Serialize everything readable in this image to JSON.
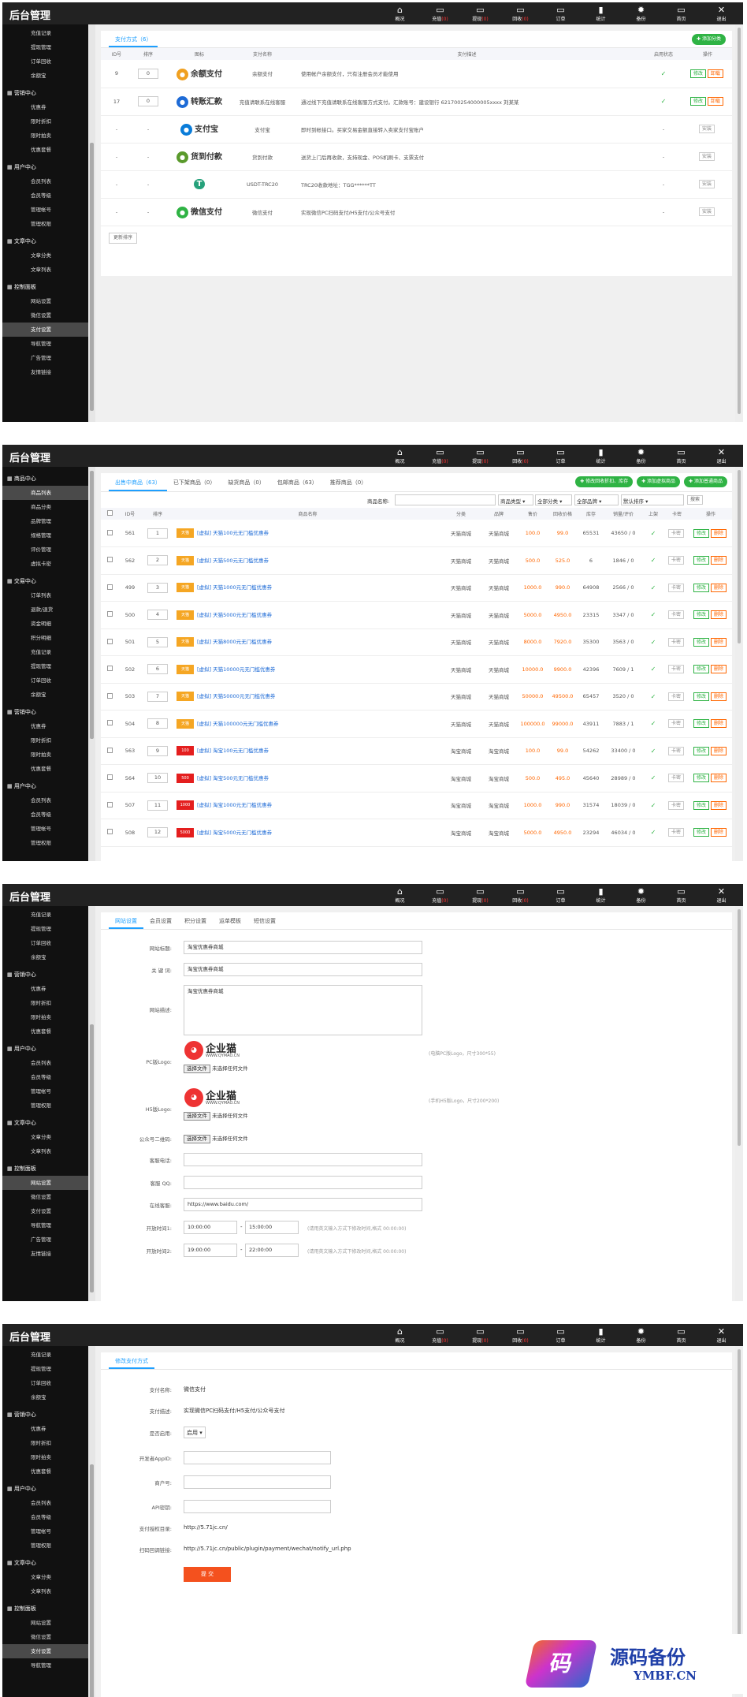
{
  "app": {
    "logo": "后台管理"
  },
  "nav": [
    {
      "icon": "home-icon",
      "label": "概况",
      "count": ""
    },
    {
      "icon": "monitor-icon",
      "label": "充值",
      "count": "(0)"
    },
    {
      "icon": "monitor-icon",
      "label": "提现",
      "count": "(0)"
    },
    {
      "icon": "monitor-icon",
      "label": "回收",
      "count": "(0)"
    },
    {
      "icon": "monitor-icon",
      "label": "订单",
      "count": ""
    },
    {
      "icon": "chart-icon",
      "label": "统计",
      "count": ""
    },
    {
      "icon": "gear-icon",
      "label": "备份",
      "count": ""
    },
    {
      "icon": "monitor-icon",
      "label": "首页",
      "count": ""
    },
    {
      "icon": "close-icon",
      "label": "退出",
      "count": ""
    }
  ],
  "panel1": {
    "sidebar": [
      {
        "type": "item",
        "label": "充值记录"
      },
      {
        "type": "item",
        "label": "提现管理"
      },
      {
        "type": "item",
        "label": "订单回收"
      },
      {
        "type": "item",
        "label": "余额宝"
      },
      {
        "type": "group",
        "label": "营销中心"
      },
      {
        "type": "item",
        "label": "优惠券"
      },
      {
        "type": "item",
        "label": "限时折扣"
      },
      {
        "type": "item",
        "label": "限时拍卖"
      },
      {
        "type": "item",
        "label": "优惠套餐"
      },
      {
        "type": "group",
        "label": "用户中心"
      },
      {
        "type": "item",
        "label": "会员列表"
      },
      {
        "type": "item",
        "label": "会员等级"
      },
      {
        "type": "item",
        "label": "管理帐号"
      },
      {
        "type": "item",
        "label": "管理权限"
      },
      {
        "type": "group",
        "label": "文章中心"
      },
      {
        "type": "item",
        "label": "文章分类"
      },
      {
        "type": "item",
        "label": "文章列表"
      },
      {
        "type": "group",
        "label": "控制面板"
      },
      {
        "type": "item",
        "label": "网站设置"
      },
      {
        "type": "item",
        "label": "微信设置"
      },
      {
        "type": "item",
        "label": "支付设置",
        "active": true
      },
      {
        "type": "item",
        "label": "导航管理"
      },
      {
        "type": "item",
        "label": "广告管理"
      },
      {
        "type": "item",
        "label": "友情链接"
      }
    ],
    "tab": "支付方式（6）",
    "add_button": "添加分类",
    "columns": [
      "ID号",
      "排序",
      "图标",
      "支付名称",
      "支付描述",
      "启用状态",
      "操作"
    ],
    "rows": [
      {
        "id": "9",
        "order": "0",
        "logo": "余额支付",
        "logo_icon": "wallet-icon",
        "logo_color": "#f0a020",
        "name": "余额支付",
        "desc": "使用帐户余额支付，只有注册会员才能使用",
        "status": "✓",
        "actions": [
          "修改",
          "卸载"
        ]
      },
      {
        "id": "17",
        "order": "0",
        "logo": "转账汇款",
        "logo_icon": "transfer-icon",
        "logo_color": "#1e6bd6",
        "name": "充值请联系在线客服",
        "desc": "通过线下充值请联系在线客服方式支付。汇款账号：建设银行 621700254000005xxxx 刘某某",
        "status": "✓",
        "actions": [
          "修改",
          "卸载"
        ]
      },
      {
        "id": "-",
        "order": "-",
        "logo": "支付宝",
        "logo_icon": "alipay-icon",
        "logo_color": "#0a7cd9",
        "name": "支付宝",
        "desc": "即时到帐接口。买家交易金额直接转入卖家支付宝账户",
        "status": "-",
        "actions": [
          "安装"
        ]
      },
      {
        "id": "-",
        "order": "-",
        "logo": "货到付款",
        "logo_icon": "truck-icon",
        "logo_color": "#5a9a2c",
        "name": "货到付款",
        "desc": "送货上门后再收款，支持现金、POS机刷卡、支票支付",
        "status": "-",
        "actions": [
          "安装"
        ]
      },
      {
        "id": "-",
        "order": "-",
        "logo": "T",
        "logo_icon": "tether-icon",
        "logo_color": "#26a17b",
        "name": "USDT-TRC20",
        "desc": "TRC20收款地址：TGG******TT",
        "status": "-",
        "actions": [
          "安装"
        ]
      },
      {
        "id": "-",
        "order": "-",
        "logo": "微信支付",
        "logo_icon": "wechat-icon",
        "logo_color": "#2fb344",
        "name": "微信支付",
        "desc": "实现微信PC扫码支付/H5支付/公众号支付",
        "status": "-",
        "actions": [
          "安装"
        ]
      }
    ],
    "update_button": "更新排序"
  },
  "panel2": {
    "sidebar": [
      {
        "type": "group",
        "label": "商品中心"
      },
      {
        "type": "item",
        "label": "商品列表",
        "active": true
      },
      {
        "type": "item",
        "label": "商品分类"
      },
      {
        "type": "item",
        "label": "品牌管理"
      },
      {
        "type": "item",
        "label": "规格管理"
      },
      {
        "type": "item",
        "label": "评价管理"
      },
      {
        "type": "item",
        "label": "虚拟卡密"
      },
      {
        "type": "group",
        "label": "交易中心"
      },
      {
        "type": "item",
        "label": "订单列表"
      },
      {
        "type": "item",
        "label": "退款/退货"
      },
      {
        "type": "item",
        "label": "资金明细"
      },
      {
        "type": "item",
        "label": "积分明细"
      },
      {
        "type": "item",
        "label": "充值记录"
      },
      {
        "type": "item",
        "label": "提现管理"
      },
      {
        "type": "item",
        "label": "订单回收"
      },
      {
        "type": "item",
        "label": "余额宝"
      },
      {
        "type": "group",
        "label": "营销中心"
      },
      {
        "type": "item",
        "label": "优惠券"
      },
      {
        "type": "item",
        "label": "限时折扣"
      },
      {
        "type": "item",
        "label": "限时拍卖"
      },
      {
        "type": "item",
        "label": "优惠套餐"
      },
      {
        "type": "group",
        "label": "用户中心"
      },
      {
        "type": "item",
        "label": "会员列表"
      },
      {
        "type": "item",
        "label": "会员等级"
      },
      {
        "type": "item",
        "label": "管理帐号"
      },
      {
        "type": "item",
        "label": "管理权限"
      }
    ],
    "tabs": [
      "出售中商品（63）",
      "已下架商品（0）",
      "缺货商品（0）",
      "包邮商品（63）",
      "推荐商品（0）"
    ],
    "buttons": [
      "修改回收折扣、库存",
      "添加虚拟商品",
      "添加普通商品"
    ],
    "filter": {
      "name_label": "商品名称:",
      "type": "商品类型",
      "category": "全部分类",
      "brand": "全部品牌",
      "sort": "默认排序",
      "search": "搜索"
    },
    "columns": [
      "",
      "ID号",
      "排序",
      "商品名称",
      "分类",
      "品牌",
      "售价",
      "回收价格",
      "库存",
      "销量/评价",
      "上架",
      "卡密",
      "操作"
    ],
    "rows": [
      {
        "id": "561",
        "order": "1",
        "thumb": "天猫",
        "name": "[虚拟] 天猫100元无门槛优惠券",
        "cat": "天猫商城",
        "brand": "天猫商城",
        "price": "100.0",
        "recycle": "99.0",
        "stock": "65531",
        "sales": "43650 / 0"
      },
      {
        "id": "562",
        "order": "2",
        "thumb": "天猫",
        "name": "[虚拟] 天猫500元无门槛优惠券",
        "cat": "天猫商城",
        "brand": "天猫商城",
        "price": "500.0",
        "recycle": "525.0",
        "stock": "6",
        "sales": "1846 / 0"
      },
      {
        "id": "499",
        "order": "3",
        "thumb": "天猫",
        "name": "[虚拟] 天猫1000元无门槛优惠券",
        "cat": "天猫商城",
        "brand": "天猫商城",
        "price": "1000.0",
        "recycle": "990.0",
        "stock": "64908",
        "sales": "2566 / 0"
      },
      {
        "id": "500",
        "order": "4",
        "thumb": "天猫",
        "name": "[虚拟] 天猫5000元无门槛优惠券",
        "cat": "天猫商城",
        "brand": "天猫商城",
        "price": "5000.0",
        "recycle": "4950.0",
        "stock": "23315",
        "sales": "3347 / 0"
      },
      {
        "id": "501",
        "order": "5",
        "thumb": "天猫",
        "name": "[虚拟] 天猫8000元无门槛优惠券",
        "cat": "天猫商城",
        "brand": "天猫商城",
        "price": "8000.0",
        "recycle": "7920.0",
        "stock": "35300",
        "sales": "3563 / 0"
      },
      {
        "id": "502",
        "order": "6",
        "thumb": "天猫",
        "name": "[虚拟] 天猫10000元无门槛优惠券",
        "cat": "天猫商城",
        "brand": "天猫商城",
        "price": "10000.0",
        "recycle": "9900.0",
        "stock": "42396",
        "sales": "7609 / 1"
      },
      {
        "id": "503",
        "order": "7",
        "thumb": "天猫",
        "name": "[虚拟] 天猫50000元无门槛优惠券",
        "cat": "天猫商城",
        "brand": "天猫商城",
        "price": "50000.0",
        "recycle": "49500.0",
        "stock": "65457",
        "sales": "3520 / 0"
      },
      {
        "id": "504",
        "order": "8",
        "thumb": "天猫",
        "name": "[虚拟] 天猫100000元无门槛优惠券",
        "cat": "天猫商城",
        "brand": "天猫商城",
        "price": "100000.0",
        "recycle": "99000.0",
        "stock": "43911",
        "sales": "7883 / 1"
      },
      {
        "id": "563",
        "order": "9",
        "thumb": "100",
        "name": "[虚拟] 淘宝100元无门槛优惠券",
        "cat": "淘宝商城",
        "brand": "淘宝商城",
        "price": "100.0",
        "recycle": "99.0",
        "stock": "54262",
        "sales": "33400 / 0"
      },
      {
        "id": "564",
        "order": "10",
        "thumb": "500",
        "name": "[虚拟] 淘宝500元无门槛优惠券",
        "cat": "淘宝商城",
        "brand": "淘宝商城",
        "price": "500.0",
        "recycle": "495.0",
        "stock": "45640",
        "sales": "28989 / 0"
      },
      {
        "id": "507",
        "order": "11",
        "thumb": "1000",
        "name": "[虚拟] 淘宝1000元无门槛优惠券",
        "cat": "淘宝商城",
        "brand": "淘宝商城",
        "price": "1000.0",
        "recycle": "990.0",
        "stock": "31574",
        "sales": "18039 / 0"
      },
      {
        "id": "508",
        "order": "12",
        "thumb": "5000",
        "name": "[虚拟] 淘宝5000元无门槛优惠券",
        "cat": "淘宝商城",
        "brand": "淘宝商城",
        "price": "5000.0",
        "recycle": "4950.0",
        "stock": "23294",
        "sales": "46034 / 0"
      }
    ],
    "row_actions": {
      "card": "卡密",
      "edit": "修改",
      "delete": "删除"
    }
  },
  "panel3": {
    "sidebar": [
      {
        "type": "item",
        "label": "充值记录"
      },
      {
        "type": "item",
        "label": "提现管理"
      },
      {
        "type": "item",
        "label": "订单回收"
      },
      {
        "type": "item",
        "label": "余额宝"
      },
      {
        "type": "group",
        "label": "营销中心"
      },
      {
        "type": "item",
        "label": "优惠券"
      },
      {
        "type": "item",
        "label": "限时折扣"
      },
      {
        "type": "item",
        "label": "限时拍卖"
      },
      {
        "type": "item",
        "label": "优惠套餐"
      },
      {
        "type": "group",
        "label": "用户中心"
      },
      {
        "type": "item",
        "label": "会员列表"
      },
      {
        "type": "item",
        "label": "会员等级"
      },
      {
        "type": "item",
        "label": "管理帐号"
      },
      {
        "type": "item",
        "label": "管理权限"
      },
      {
        "type": "group",
        "label": "文章中心"
      },
      {
        "type": "item",
        "label": "文章分类"
      },
      {
        "type": "item",
        "label": "文章列表"
      },
      {
        "type": "group",
        "label": "控制面板"
      },
      {
        "type": "item",
        "label": "网站设置",
        "active": true
      },
      {
        "type": "item",
        "label": "微信设置"
      },
      {
        "type": "item",
        "label": "支付设置"
      },
      {
        "type": "item",
        "label": "导航管理"
      },
      {
        "type": "item",
        "label": "广告管理"
      },
      {
        "type": "item",
        "label": "友情链接"
      }
    ],
    "tabs": [
      "网站设置",
      "会员设置",
      "积分设置",
      "运单模板",
      "短信设置"
    ],
    "fields": {
      "title_label": "网站标题:",
      "title_value": "淘宝优惠券商城",
      "keywords_label": "关 键 词:",
      "keywords_value": "淘宝优惠券商城",
      "desc_label": "网站描述:",
      "desc_value": "淘宝优惠券商城",
      "pc_logo_label": "PC版Logo:",
      "pc_logo_hint": "(电脑PC版Logo，尺寸300*55)",
      "h5_logo_label": "H5版Logo:",
      "h5_logo_hint": "(手机H5版Logo，尺寸200*200)",
      "qr_label": "公众号二维码:",
      "file_button": "选择文件",
      "file_none": "未选择任何文件",
      "logo_text": "企业猫",
      "logo_sub": "WWW.QYMAO.CN",
      "phone_label": "客服电话:",
      "qq_label": "客服 QQ:",
      "online_label": "在线客服:",
      "online_value": "https://www.baidu.com/",
      "time1_label": "开放时间1:",
      "time1_start": "10:00:00",
      "time1_end": "15:00:00",
      "time2_label": "开放时间2:",
      "time2_start": "19:00:00",
      "time2_end": "22:00:00",
      "time_hint": "(请用英文输入方式下修改时间,格式 00:00:00)"
    }
  },
  "panel4": {
    "sidebar": [
      {
        "type": "item",
        "label": "充值记录"
      },
      {
        "type": "item",
        "label": "提现管理"
      },
      {
        "type": "item",
        "label": "订单回收"
      },
      {
        "type": "item",
        "label": "余额宝"
      },
      {
        "type": "group",
        "label": "营销中心"
      },
      {
        "type": "item",
        "label": "优惠券"
      },
      {
        "type": "item",
        "label": "限时折扣"
      },
      {
        "type": "item",
        "label": "限时拍卖"
      },
      {
        "type": "item",
        "label": "优惠套餐"
      },
      {
        "type": "group",
        "label": "用户中心"
      },
      {
        "type": "item",
        "label": "会员列表"
      },
      {
        "type": "item",
        "label": "会员等级"
      },
      {
        "type": "item",
        "label": "管理帐号"
      },
      {
        "type": "item",
        "label": "管理权限"
      },
      {
        "type": "group",
        "label": "文章中心"
      },
      {
        "type": "item",
        "label": "文章分类"
      },
      {
        "type": "item",
        "label": "文章列表"
      },
      {
        "type": "group",
        "label": "控制面板"
      },
      {
        "type": "item",
        "label": "网站设置"
      },
      {
        "type": "item",
        "label": "微信设置"
      },
      {
        "type": "item",
        "label": "支付设置",
        "active": true
      },
      {
        "type": "item",
        "label": "导航管理"
      }
    ],
    "tab": "修改支付方式",
    "fields": {
      "name_label": "支付名称:",
      "name_value": "微信支付",
      "desc_label": "支付描述:",
      "desc_value": "实现微信PC扫码支付/H5支付/公众号支付",
      "enable_label": "是否启用:",
      "enable_value": "启用",
      "appid_label": "开发者AppID:",
      "mch_label": "商户号:",
      "api_label": "API密钥:",
      "auth_label": "支付授权目录:",
      "auth_value": "http://5.71jc.cn/",
      "notify_label": "扫码回调链接:",
      "notify_value": "http://5.71jc.cn/public/plugin/payment/wechat/notify_url.php",
      "submit": "提 交"
    }
  },
  "watermark": {
    "main": "源码备份",
    "sub": "YMBF.CN",
    "glyph": "码"
  }
}
